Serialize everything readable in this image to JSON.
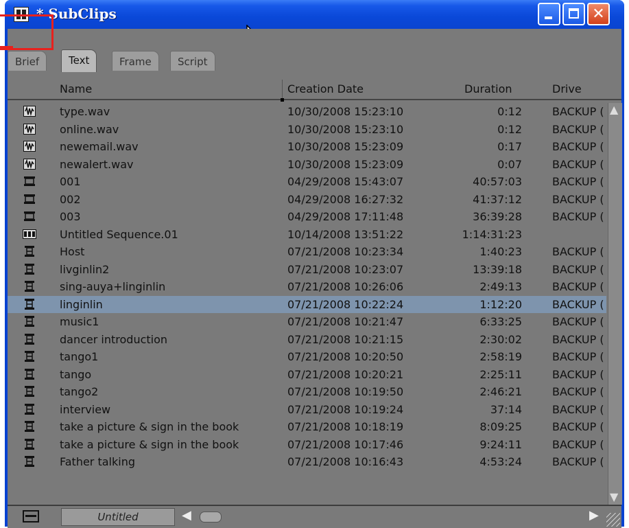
{
  "window": {
    "title": "* SubClips"
  },
  "tabs": [
    {
      "label": "Brief",
      "active": false
    },
    {
      "label": "Text",
      "active": true
    },
    {
      "label": "Frame",
      "active": false
    },
    {
      "label": "Script",
      "active": false
    }
  ],
  "columns": {
    "name": "Name",
    "creation_date": "Creation Date",
    "duration": "Duration",
    "drive": "Drive"
  },
  "rows": [
    {
      "icon": "audio-clip-icon",
      "name": "type.wav",
      "date": "10/30/2008 15:23:10",
      "duration": "0:12",
      "drive": "BACKUP ("
    },
    {
      "icon": "audio-clip-icon",
      "name": "online.wav",
      "date": "10/30/2008 15:23:10",
      "duration": "0:12",
      "drive": "BACKUP ("
    },
    {
      "icon": "audio-clip-icon",
      "name": "newemail.wav",
      "date": "10/30/2008 15:23:09",
      "duration": "0:17",
      "drive": "BACKUP ("
    },
    {
      "icon": "audio-clip-icon",
      "name": "newalert.wav",
      "date": "10/30/2008 15:23:09",
      "duration": "0:07",
      "drive": "BACKUP ("
    },
    {
      "icon": "master-clip-icon",
      "name": "001",
      "date": "04/29/2008 15:43:07",
      "duration": "40:57:03",
      "drive": "BACKUP ("
    },
    {
      "icon": "master-clip-icon",
      "name": "002",
      "date": "04/29/2008 16:27:32",
      "duration": "41:37:12",
      "drive": "BACKUP ("
    },
    {
      "icon": "master-clip-icon",
      "name": "003",
      "date": "04/29/2008 17:11:48",
      "duration": "36:39:28",
      "drive": "BACKUP ("
    },
    {
      "icon": "sequence-icon",
      "name": "Untitled Sequence.01",
      "date": "10/14/2008 13:51:22",
      "duration": "1:14:31:23",
      "drive": ""
    },
    {
      "icon": "subclip-icon",
      "name": "Host",
      "date": "07/21/2008 10:23:34",
      "duration": "1:40:23",
      "drive": "BACKUP ("
    },
    {
      "icon": "subclip-icon",
      "name": "livginlin2",
      "date": "07/21/2008 10:23:07",
      "duration": "13:39:18",
      "drive": "BACKUP ("
    },
    {
      "icon": "subclip-icon",
      "name": "sing-auya+linginlin",
      "date": "07/21/2008 10:26:06",
      "duration": "2:49:13",
      "drive": "BACKUP ("
    },
    {
      "icon": "subclip-icon",
      "name": "linginlin",
      "date": "07/21/2008 10:22:24",
      "duration": "1:12:20",
      "drive": "BACKUP (",
      "selected": true
    },
    {
      "icon": "subclip-icon",
      "name": "music1",
      "date": "07/21/2008 10:21:47",
      "duration": "6:33:25",
      "drive": "BACKUP ("
    },
    {
      "icon": "subclip-icon",
      "name": "dancer introduction",
      "date": "07/21/2008 10:21:15",
      "duration": "2:30:02",
      "drive": "BACKUP ("
    },
    {
      "icon": "subclip-icon",
      "name": "tango1",
      "date": "07/21/2008 10:20:50",
      "duration": "2:58:19",
      "drive": "BACKUP ("
    },
    {
      "icon": "subclip-icon",
      "name": "tango",
      "date": "07/21/2008 10:20:21",
      "duration": "2:25:11",
      "drive": "BACKUP ("
    },
    {
      "icon": "subclip-icon",
      "name": "tango2",
      "date": "07/21/2008 10:19:50",
      "duration": "2:46:21",
      "drive": "BACKUP ("
    },
    {
      "icon": "subclip-icon",
      "name": "interview",
      "date": "07/21/2008 10:19:24",
      "duration": "37:14",
      "drive": "BACKUP ("
    },
    {
      "icon": "subclip-icon",
      "name": "take a picture & sign in the book",
      "date": "07/21/2008 10:18:19",
      "duration": "8:09:25",
      "drive": "BACKUP ("
    },
    {
      "icon": "subclip-icon",
      "name": "take a picture & sign in the book",
      "date": "07/21/2008 10:17:46",
      "duration": "9:24:11",
      "drive": "BACKUP ("
    },
    {
      "icon": "subclip-icon",
      "name": "Father talking",
      "date": "07/21/2008 10:16:43",
      "duration": "4:53:24",
      "drive": "BACKUP ("
    }
  ],
  "footer": {
    "view_name": "Untitled"
  },
  "colors": {
    "titlebar": "#0a48d8",
    "panel": "#7a7a7a",
    "selection": "#7e94ad",
    "highlight": "#e8211d"
  }
}
